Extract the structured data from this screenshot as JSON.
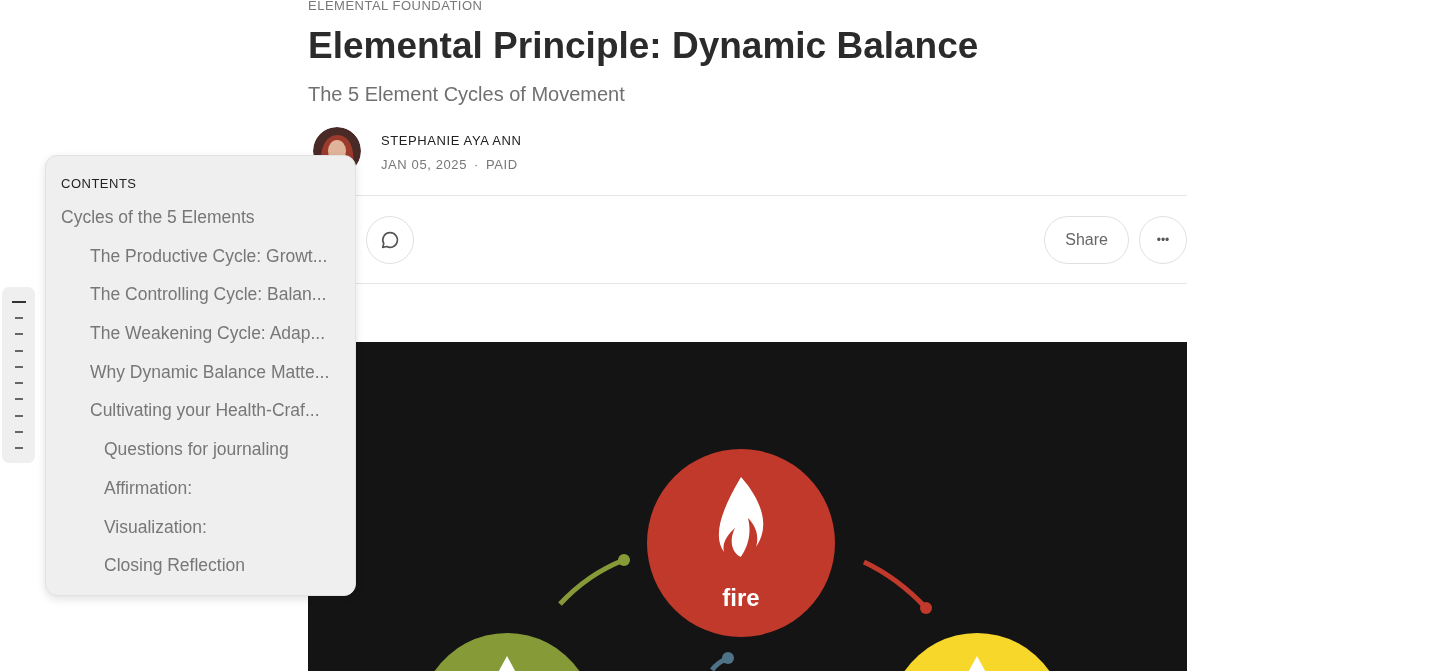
{
  "post": {
    "section": "ELEMENTAL FOUNDATION",
    "title": "Elemental Principle: Dynamic Balance",
    "subtitle": "The 5 Element Cycles of Movement",
    "author": "STEPHANIE AYA ANN",
    "date": "JAN 05, 2025",
    "separator": "·",
    "access": "PAID"
  },
  "actions": {
    "share": "Share",
    "more": "•••"
  },
  "figure": {
    "nodes": [
      {
        "label": "fire",
        "color": "#c0392b"
      },
      {
        "color": "#869a38"
      },
      {
        "color": "#f7d72a"
      }
    ]
  },
  "mini_nav": [
    {
      "selected": true
    },
    {
      "selected": false
    },
    {
      "selected": false
    },
    {
      "selected": false
    },
    {
      "selected": false
    },
    {
      "selected": false
    },
    {
      "selected": false
    },
    {
      "selected": false
    },
    {
      "selected": false
    },
    {
      "selected": false
    }
  ],
  "contents": {
    "heading": "CONTENTS",
    "items": [
      {
        "label": "Cycles of the 5 Elements",
        "children": [
          {
            "label": "The Productive Cycle: Growt..."
          },
          {
            "label": "The Controlling Cycle: Balan..."
          },
          {
            "label": "The Weakening Cycle: Adap..."
          },
          {
            "label": "Why Dynamic Balance Matte..."
          },
          {
            "label": "Cultivating your Health-Craf...",
            "children": [
              {
                "label": "Questions for journaling"
              },
              {
                "label": "Affirmation:"
              },
              {
                "label": "Visualization:"
              },
              {
                "label": "Closing Reflection"
              }
            ]
          }
        ]
      }
    ]
  }
}
